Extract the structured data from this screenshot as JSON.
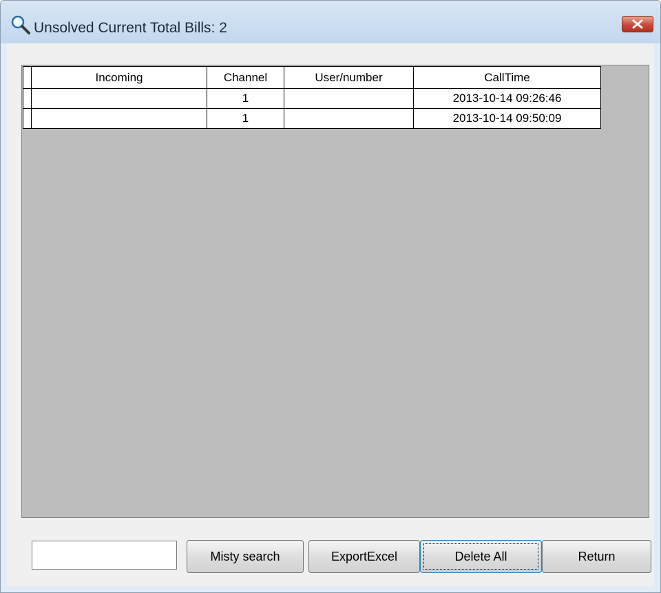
{
  "window": {
    "title": "Unsolved  Current Total Bills: 2",
    "icon": "magnifier-icon",
    "close_icon": "close-icon"
  },
  "table": {
    "columns": [
      "Incoming",
      "Channel",
      "User/number",
      "CallTime"
    ],
    "rows": [
      {
        "incoming": "",
        "channel": "1",
        "user_number": "",
        "call_time": "2013-10-14 09:26:46"
      },
      {
        "incoming": "",
        "channel": "1",
        "user_number": "",
        "call_time": "2013-10-14 09:50:09"
      }
    ]
  },
  "search": {
    "value": "",
    "placeholder": ""
  },
  "buttons": {
    "misty_search": "Misty search",
    "export_excel": "ExportExcel",
    "delete_all": "Delete All",
    "return": "Return"
  },
  "colors": {
    "grid_background": "#bdbdbd",
    "close_button": "#c8493a",
    "focus_border": "#3c7fb1"
  }
}
